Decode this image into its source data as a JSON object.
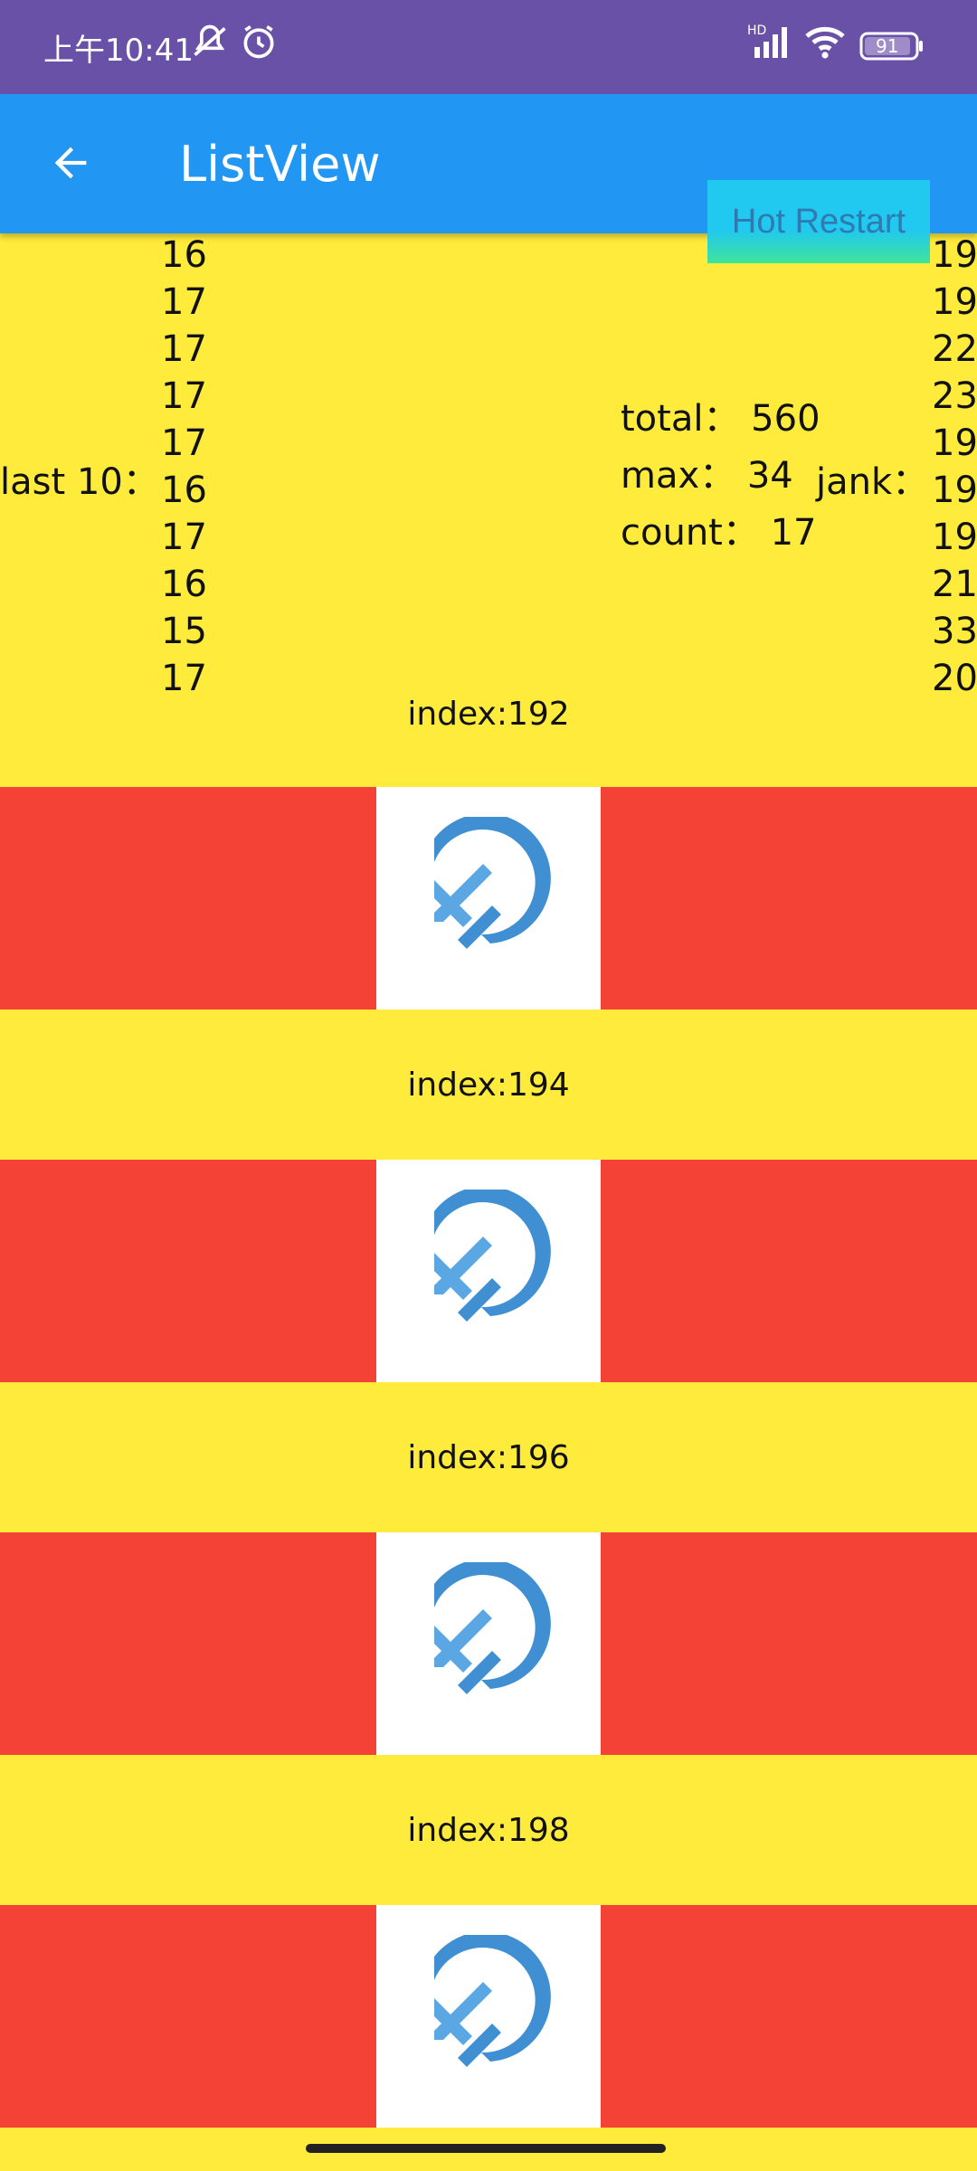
{
  "status_bar": {
    "time": "上午10:41",
    "battery": "91",
    "network": "HD",
    "icons": [
      "mute-bell-icon",
      "alarm-icon",
      "signal-icon",
      "wifi-icon",
      "battery-icon"
    ]
  },
  "app_bar": {
    "title": "ListView",
    "back_icon": "arrow-back-icon"
  },
  "hot_restart": {
    "label": "Hot Restart"
  },
  "perf": {
    "last10_label": "last 10：",
    "last10_values": [
      "16",
      "17",
      "17",
      "17",
      "17",
      "16",
      "17",
      "16",
      "15",
      "17"
    ],
    "total": "total： 560",
    "max": "max： 34",
    "count": "count： 17",
    "jank_label": "jank：",
    "jank_values": [
      "19",
      "19",
      "22",
      "23",
      "19",
      "19",
      "19",
      "21",
      "33",
      "20"
    ]
  },
  "list": {
    "items": [
      {
        "type": "text",
        "label": "index:192"
      },
      {
        "type": "image",
        "icon": "flutter-logo-icon"
      },
      {
        "type": "text",
        "label": "index:194"
      },
      {
        "type": "image",
        "icon": "flutter-logo-icon"
      },
      {
        "type": "text",
        "label": "index:196"
      },
      {
        "type": "image",
        "icon": "flutter-logo-icon"
      },
      {
        "type": "text",
        "label": "index:198"
      },
      {
        "type": "image",
        "icon": "flutter-logo-icon"
      }
    ]
  },
  "colors": {
    "status_bar": "#6A51A8",
    "app_bar": "#2196F3",
    "yellow_row": "#FFEB3B",
    "red_row": "#F44336",
    "logo_blue": "#3F8FD2"
  }
}
